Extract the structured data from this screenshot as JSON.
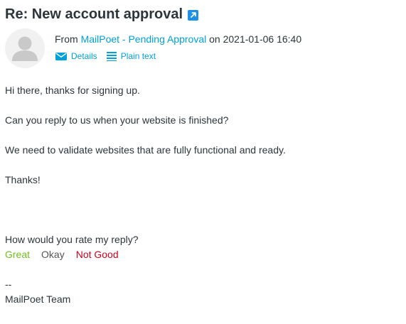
{
  "message": {
    "subject": "Re: New account approval",
    "from_prefix": "From",
    "sender": "MailPoet - Pending Approval",
    "date_prefix": "on",
    "date": "2021-01-06 16:40",
    "links": {
      "details": "Details",
      "plain_text": "Plain text"
    },
    "body": {
      "greeting": "Hi there, thanks for signing up.",
      "question": "Can you reply to us when your website is finished?",
      "validation": "We need to validate websites that are fully functional and ready.",
      "thanks": "Thanks!",
      "rating_prompt": "How would you rate my reply?",
      "rating_options": {
        "great": "Great",
        "okay": "Okay",
        "not_good": "Not Good"
      },
      "signature_separator": "--",
      "signature": "MailPoet Team"
    }
  },
  "colors": {
    "link": "#00a1db",
    "great": "#6fbf1e",
    "okay": "#555555",
    "not_good": "#d0021b",
    "text": "#2c363a"
  },
  "icons": {
    "external": "external-link-icon",
    "avatar": "user-avatar-icon",
    "details": "envelope-icon",
    "plain_text": "lines-icon"
  }
}
